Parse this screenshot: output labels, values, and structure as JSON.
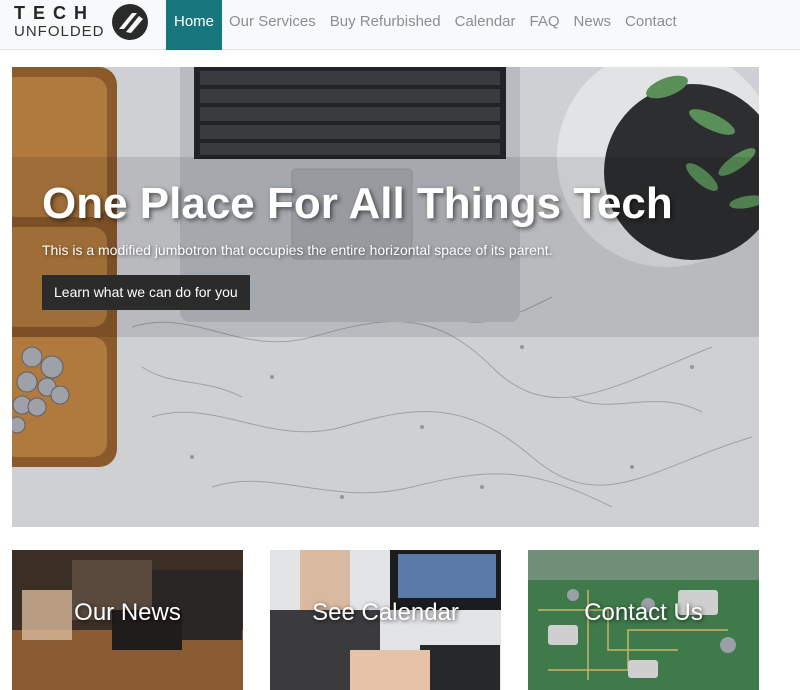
{
  "brand": {
    "line1": "TECH",
    "line2": "UNFOLDED",
    "logo_icon": "slash-circle-logo"
  },
  "nav": {
    "items": [
      {
        "label": "Home",
        "active": true
      },
      {
        "label": "Our Services",
        "active": false
      },
      {
        "label": "Buy Refurbished",
        "active": false
      },
      {
        "label": "Calendar",
        "active": false
      },
      {
        "label": "FAQ",
        "active": false
      },
      {
        "label": "News",
        "active": false
      },
      {
        "label": "Contact",
        "active": false
      }
    ]
  },
  "hero": {
    "title": "One Place For All Things Tech",
    "subtitle": "This is a modified jumbotron that occupies the entire horizontal space of its parent.",
    "button_label": "Learn what we can do for you"
  },
  "cards": [
    {
      "label": "Our News"
    },
    {
      "label": "See Calendar"
    },
    {
      "label": "Contact Us"
    }
  ],
  "colors": {
    "accent": "#17777d",
    "nav_bg": "#f8f9fa",
    "nav_text": "#8a8f94",
    "button_bg": "#2b2b2b"
  }
}
